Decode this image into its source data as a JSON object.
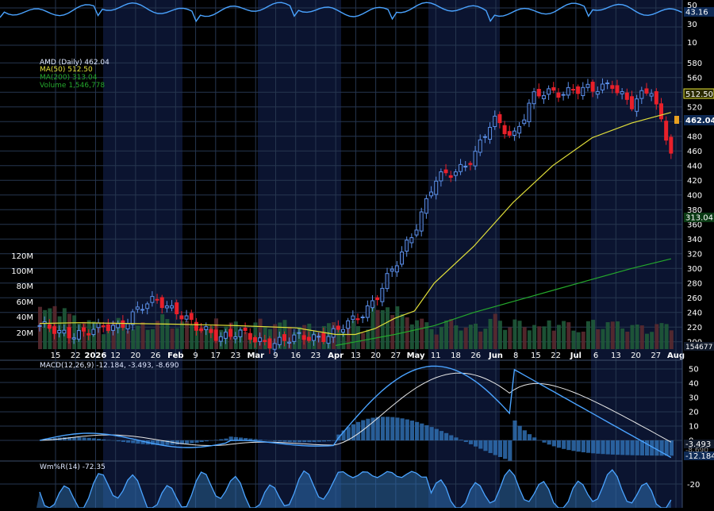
{
  "colors": {
    "background": "#000000",
    "shade": "#0b1430",
    "grid": "#26364f",
    "axis_text": "#ffffff",
    "price_up": "#5b8fe8",
    "price_down": "#e8202a",
    "ma50": "#e2e03a",
    "ma200": "#24a82c",
    "volume": "#1f5a3a",
    "macd_line": "#4aa3ff",
    "macd_signal": "#e8e8e8",
    "macd_hist": "#2f6db0",
    "wr_line": "#4aa3ff"
  },
  "top_indicator": {
    "last_label": "43.16",
    "ticks": [
      "50",
      "30",
      "10"
    ]
  },
  "legend": {
    "price": "AMD (Daily) 462.04",
    "ma50": "MA(50) 512.50",
    "ma200": "MA(200) 313.04",
    "volume": "Volume 1,546,778"
  },
  "price_axis": {
    "ticks": [
      "580",
      "560",
      "540",
      "520",
      "500",
      "480",
      "460",
      "440",
      "420",
      "400",
      "380",
      "360",
      "340",
      "320",
      "300",
      "280",
      "260",
      "240",
      "220",
      "200"
    ],
    "last_price_label": "462.04",
    "ma50_label": "512.50",
    "ma200_label": "313.04"
  },
  "volume_axis": {
    "ticks": [
      "120M",
      "100M",
      "80M",
      "60M",
      "40M",
      "20M"
    ],
    "last_volume_label": "154677"
  },
  "date_axis": {
    "labels": [
      "15",
      "22",
      "2026",
      "12",
      "20",
      "26",
      "Feb",
      "9",
      "17",
      "23",
      "Mar",
      "9",
      "16",
      "23",
      "Apr",
      "13",
      "20",
      "27",
      "May",
      "11",
      "18",
      "26",
      "Jun",
      "8",
      "15",
      "22",
      "Jul",
      "6",
      "13",
      "20",
      "27",
      "Aug"
    ]
  },
  "macd_panel": {
    "legend": "MACD(12,26,9) -12.184, -3.493, -8.690",
    "ticks": [
      "50",
      "40",
      "30",
      "20",
      "10",
      "0"
    ],
    "signal_label": "-3.493",
    "macd_label": "-12.184",
    "hist_label": "-8.690"
  },
  "wr_panel": {
    "legend": "Wm%R(14) -72.35",
    "ticks": [
      "-20"
    ]
  },
  "chart_data": {
    "type": "candlestick",
    "symbol": "AMD",
    "interval": "Daily",
    "ylim": [
      190,
      590
    ],
    "volume_ylim": [
      0,
      130
    ],
    "series": [
      {
        "name": "AMD (Daily)",
        "kind": "ohlc",
        "close_points": [
          [
            "Jan 8",
            222
          ],
          [
            "Jan 15",
            210
          ],
          [
            "Jan 22",
            214
          ],
          [
            "2026",
            216
          ],
          [
            "Jan 12",
            222
          ],
          [
            "Jan 20",
            245
          ],
          [
            "Jan 26",
            255
          ],
          [
            "Feb",
            244
          ],
          [
            "Feb 9",
            215
          ],
          [
            "Feb 17",
            210
          ],
          [
            "Feb 23",
            212
          ],
          [
            "Mar",
            200
          ],
          [
            "Mar 9",
            202
          ],
          [
            "Mar 16",
            203
          ],
          [
            "Mar 23",
            208
          ],
          [
            "Apr",
            212
          ],
          [
            "Apr 13",
            230
          ],
          [
            "Apr 20",
            260
          ],
          [
            "Apr 27",
            300
          ],
          [
            "May",
            355
          ],
          [
            "May 11",
            418
          ],
          [
            "May 18",
            430
          ],
          [
            "May 26",
            455
          ],
          [
            "Jun",
            500
          ],
          [
            "Jun 8",
            482
          ],
          [
            "Jun 15",
            532
          ],
          [
            "Jun 22",
            540
          ],
          [
            "Jul",
            545
          ],
          [
            "Jul 6",
            540
          ],
          [
            "Jul 13",
            555
          ],
          [
            "Jul 20",
            520
          ],
          [
            "Jul 27",
            545
          ],
          [
            "Aug",
            462
          ]
        ]
      },
      {
        "name": "MA(50)",
        "points": [
          [
            "Jan 8",
            225
          ],
          [
            "Jan 22",
            226
          ],
          [
            "Feb",
            224
          ],
          [
            "Feb 23",
            222
          ],
          [
            "Mar 16",
            219
          ],
          [
            "Apr",
            210
          ],
          [
            "Apr 13",
            210
          ],
          [
            "Apr 20",
            218
          ],
          [
            "Apr 27",
            232
          ],
          [
            "May",
            242
          ],
          [
            "May 11",
            280
          ],
          [
            "May 26",
            330
          ],
          [
            "Jun 8",
            390
          ],
          [
            "Jun 22",
            440
          ],
          [
            "Jul 6",
            478
          ],
          [
            "Jul 20",
            498
          ],
          [
            "Aug",
            512.5
          ]
        ]
      },
      {
        "name": "MA(200)",
        "points": [
          [
            "Apr",
            195
          ],
          [
            "Apr 13",
            200
          ],
          [
            "Apr 27",
            210
          ],
          [
            "May 11",
            222
          ],
          [
            "May 26",
            240
          ],
          [
            "Jun 8",
            255
          ],
          [
            "Jun 22",
            270
          ],
          [
            "Jul 6",
            285
          ],
          [
            "Jul 20",
            300
          ],
          [
            "Aug",
            313.04
          ]
        ]
      },
      {
        "name": "Volume",
        "unit": "M",
        "values": [
          55,
          45,
          50,
          60,
          48,
          52,
          40,
          42,
          38,
          40,
          35,
          30,
          28,
          25,
          30,
          32,
          35,
          34,
          30,
          28,
          26,
          30,
          27,
          32,
          38,
          40,
          35,
          30,
          33,
          36,
          31,
          28,
          30,
          35,
          26,
          24,
          38,
          30,
          34,
          32,
          30,
          26,
          28,
          24,
          31,
          34,
          29,
          32,
          35,
          30,
          33,
          31,
          28,
          30,
          26,
          29,
          25,
          27,
          30,
          28,
          32,
          30,
          27,
          29,
          31,
          28,
          26,
          30
        ]
      },
      {
        "name": "MACD(12,26,9)",
        "last": -12.184,
        "signal_last": -3.493,
        "hist_last": -8.69
      },
      {
        "name": "Wm%R(14)",
        "last": -72.35
      }
    ]
  }
}
